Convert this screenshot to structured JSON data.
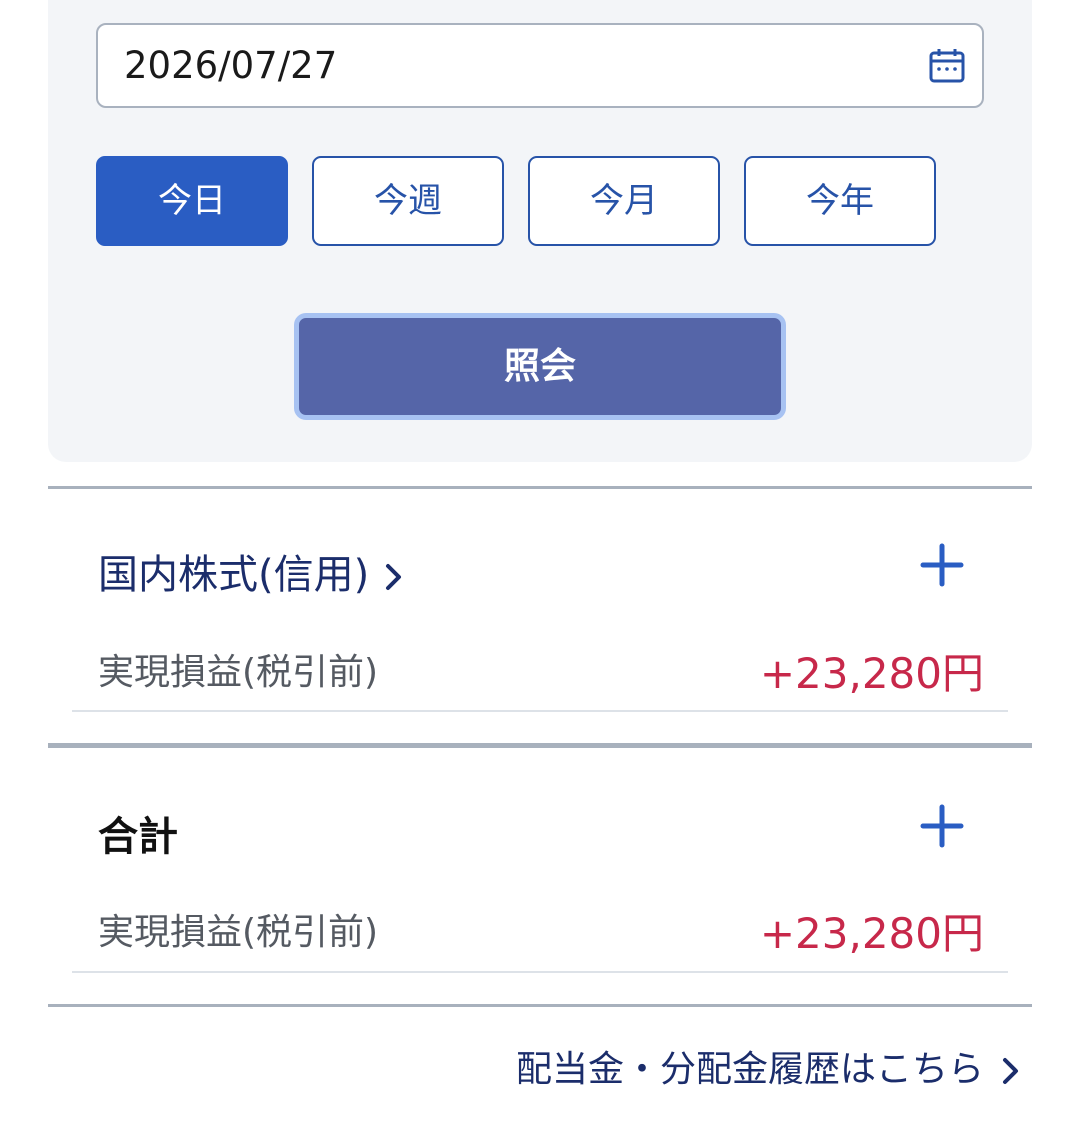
{
  "search": {
    "date_value": "2026/07/27",
    "period_buttons": [
      {
        "label": "今日",
        "active": true
      },
      {
        "label": "今週",
        "active": false
      },
      {
        "label": "今月",
        "active": false
      },
      {
        "label": "今年",
        "active": false
      }
    ],
    "query_label": "照会"
  },
  "sections": [
    {
      "title": "国内株式(信用)",
      "row_label": "実現損益(税引前)",
      "row_value": "+23,280円"
    },
    {
      "title": "合計",
      "row_label": "実現損益(税引前)",
      "row_value": "+23,280円"
    }
  ],
  "footer": {
    "link_label": "配当金・分配金履歴はこちら"
  },
  "colors": {
    "accent": "#2a5dc3",
    "navy_text": "#1b2d6b",
    "profit": "#c7284a",
    "query_button": "#5565a8"
  },
  "icons": [
    "calendar-icon",
    "chevron-right-icon",
    "plus-icon"
  ]
}
